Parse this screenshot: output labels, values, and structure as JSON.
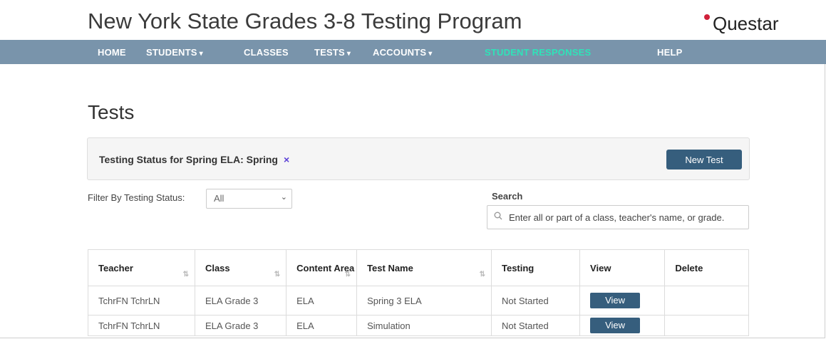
{
  "header": {
    "title": "New York State Grades 3-8 Testing Program",
    "brand": "Questar"
  },
  "nav": {
    "items": [
      {
        "label": "HOME",
        "has_caret": false
      },
      {
        "label": "STUDENTS",
        "has_caret": true
      },
      {
        "label": "CLASSES",
        "has_caret": false
      },
      {
        "label": "TESTS",
        "has_caret": true
      },
      {
        "label": "ACCOUNTS",
        "has_caret": true
      },
      {
        "label": "STUDENT RESPONSES",
        "has_caret": false
      },
      {
        "label": "HELP",
        "has_caret": false
      }
    ],
    "caret": "▾"
  },
  "page": {
    "title": "Tests"
  },
  "status_panel": {
    "text": "Testing Status for Spring ELA: ",
    "tag": "Spring",
    "close": "×",
    "new_test_label": "New Test"
  },
  "filters": {
    "status_label": "Filter By Testing Status:",
    "status_value": "All",
    "chevron": "⌄"
  },
  "search": {
    "label": "Search",
    "placeholder": "Enter all or part of a class, teacher's name, or grade."
  },
  "table": {
    "headers": [
      "Teacher",
      "Class",
      "Content Area",
      "Test Name",
      "Testing",
      "View",
      "Delete"
    ],
    "sort_glyph": "⇅",
    "rows": [
      {
        "teacher": "TchrFN TchrLN",
        "class": "ELA Grade 3",
        "area": "ELA",
        "test": "Spring 3 ELA",
        "status": "Not Started",
        "view": "View"
      },
      {
        "teacher": "TchrFN TchrLN",
        "class": "ELA Grade 3",
        "area": "ELA",
        "test": "Simulation",
        "status": "Not Started",
        "view": "View"
      }
    ]
  },
  "colors": {
    "nav_bg": "#7994ab",
    "nav_active": "#2fe3b8",
    "button_bg": "#365e7d"
  }
}
